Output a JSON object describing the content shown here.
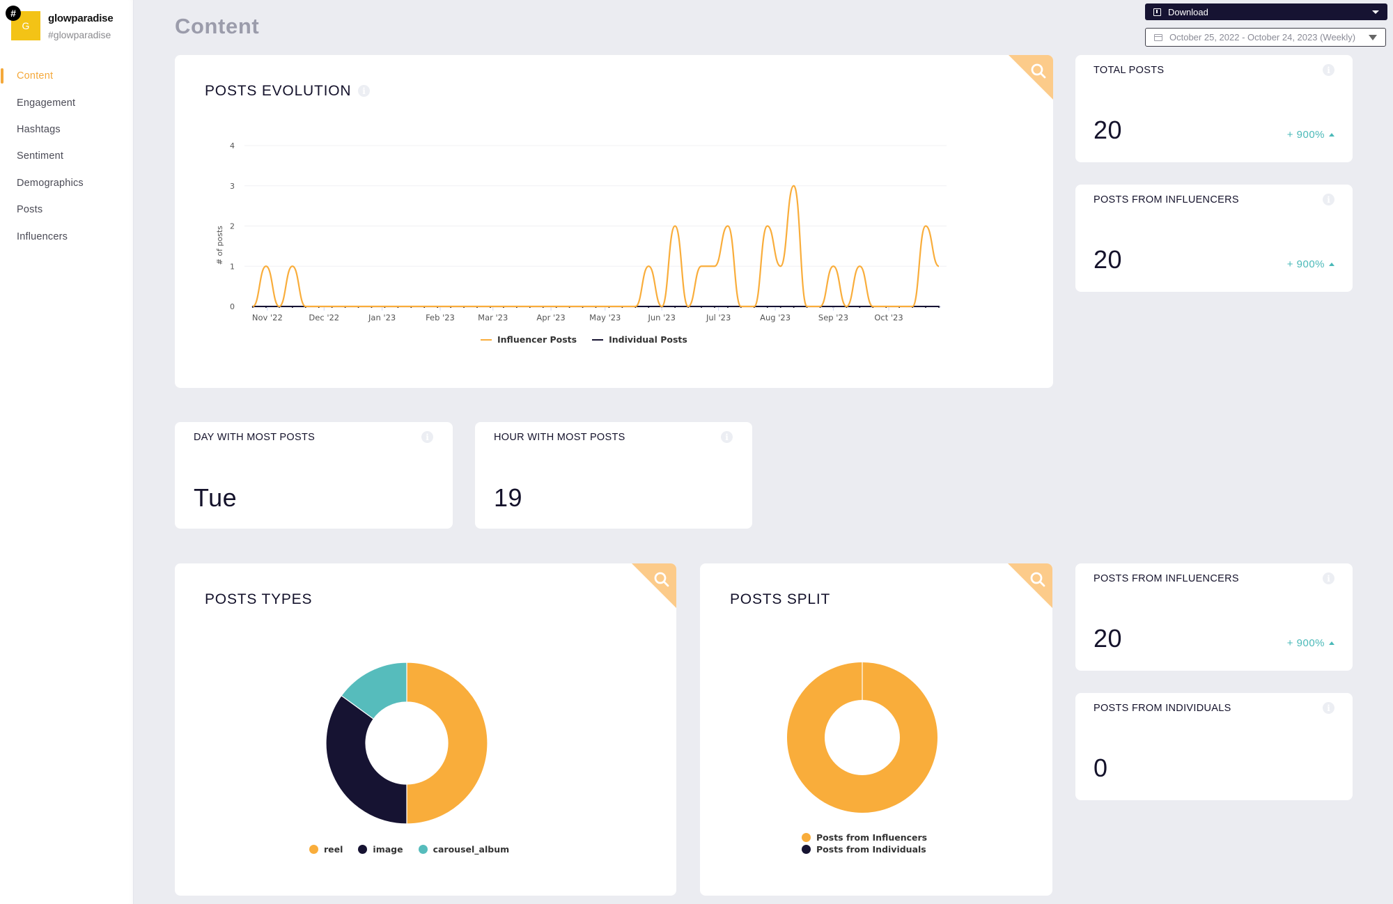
{
  "brand": {
    "avatar_letter": "G",
    "badge": "#",
    "name": "glowparadise",
    "handle": "#glowparadise"
  },
  "sidebar": {
    "items": [
      {
        "label": "Content",
        "active": true
      },
      {
        "label": "Engagement",
        "active": false
      },
      {
        "label": "Hashtags",
        "active": false
      },
      {
        "label": "Sentiment",
        "active": false
      },
      {
        "label": "Demographics",
        "active": false
      },
      {
        "label": "Posts",
        "active": false
      },
      {
        "label": "Influencers",
        "active": false
      }
    ]
  },
  "header": {
    "title": "Content",
    "download_label": "Download",
    "date_range": "October 25, 2022 - October 24, 2023 (Weekly)"
  },
  "colors": {
    "accent": "#f4a83a",
    "orange": "#f9ad3b",
    "navy": "#161332",
    "teal": "#56bcbc",
    "positive": "#4ab9b8",
    "zoom_corner": "#fccb8a"
  },
  "posts_evolution": {
    "title": "POSTS EVOLUTION"
  },
  "kpis": {
    "total_posts": {
      "title": "TOTAL POSTS",
      "value": "20",
      "change": "+ 900%"
    },
    "posts_from_influencers": {
      "title": "POSTS FROM INFLUENCERS",
      "value": "20",
      "change": "+ 900%"
    },
    "day_most_posts": {
      "title": "DAY WITH MOST POSTS",
      "value": "Tue"
    },
    "hour_most_posts": {
      "title": "HOUR WITH MOST POSTS",
      "value": "19"
    },
    "posts_from_influencers_2": {
      "title": "POSTS FROM INFLUENCERS",
      "value": "20",
      "change": "+ 900%"
    },
    "posts_from_individuals": {
      "title": "POSTS FROM INDIVIDUALS",
      "value": "0"
    }
  },
  "posts_types": {
    "title": "POSTS TYPES"
  },
  "posts_split": {
    "title": "POSTS SPLIT"
  },
  "chart_data": [
    {
      "type": "line",
      "title": "POSTS EVOLUTION",
      "xlabel": "",
      "ylabel": "# of posts",
      "ylim": [
        0,
        4
      ],
      "yticks": [
        0,
        1,
        2,
        3,
        4
      ],
      "x_tick_labels": [
        "Nov '22",
        "Dec '22",
        "Jan '23",
        "Feb '23",
        "Mar '23",
        "Apr '23",
        "May '23",
        "Jun '23",
        "Jul '23",
        "Aug '23",
        "Sep '23",
        "Oct '23"
      ],
      "x_tick_week_index": [
        1.1,
        5.4,
        9.8,
        14.2,
        18.2,
        22.6,
        26.7,
        31.0,
        35.3,
        39.6,
        44.0,
        48.2
      ],
      "x_week_count": 53,
      "grid": true,
      "legend_position": "bottom",
      "series": [
        {
          "name": "Influencer Posts",
          "color": "#f9ad3b",
          "values": [
            0,
            1,
            0,
            1,
            0,
            0,
            0,
            0,
            0,
            0,
            0,
            0,
            0,
            0,
            0,
            0,
            0,
            0,
            0,
            0,
            0,
            0,
            0,
            0,
            0,
            0,
            0,
            0,
            0,
            0,
            1,
            0,
            2,
            0,
            1,
            1,
            2,
            0,
            0,
            2,
            1,
            3,
            0,
            0,
            1,
            0,
            1,
            0,
            0,
            0,
            0,
            2,
            1
          ]
        },
        {
          "name": "Individual Posts",
          "color": "#161332",
          "values": [
            0,
            0,
            0,
            0,
            0,
            0,
            0,
            0,
            0,
            0,
            0,
            0,
            0,
            0,
            0,
            0,
            0,
            0,
            0,
            0,
            0,
            0,
            0,
            0,
            0,
            0,
            0,
            0,
            0,
            0,
            0,
            0,
            0,
            0,
            0,
            0,
            0,
            0,
            0,
            0,
            0,
            0,
            0,
            0,
            0,
            0,
            0,
            0,
            0,
            0,
            0,
            0,
            0
          ]
        }
      ]
    },
    {
      "type": "pie",
      "title": "POSTS TYPES",
      "donut": true,
      "legend_position": "bottom",
      "categories": [
        "reel",
        "image",
        "carousel_album"
      ],
      "values": [
        10,
        7,
        3
      ],
      "colors": [
        "#f9ad3b",
        "#161332",
        "#56bcbc"
      ]
    },
    {
      "type": "pie",
      "title": "POSTS SPLIT",
      "donut": true,
      "legend_position": "bottom",
      "categories": [
        "Posts from Influencers",
        "Posts from Individuals"
      ],
      "values": [
        20,
        0
      ],
      "colors": [
        "#f9ad3b",
        "#161332"
      ]
    }
  ]
}
